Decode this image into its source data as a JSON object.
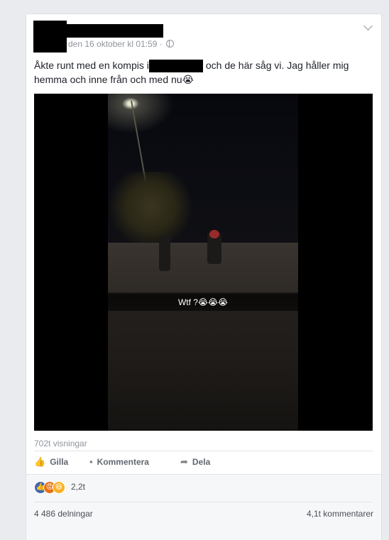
{
  "post": {
    "timestamp": "den 16 oktober kl 01:59 ·",
    "text_part1": "Åkte runt med en kompis i",
    "text_part2": "och de här såg vi. Jag håller mig hemma och inne från och med nu",
    "text_emoji": "😭"
  },
  "video": {
    "caption": "Wtf ?😭😭😭",
    "views": "702t visningar"
  },
  "actions": {
    "like_label": "Gilla",
    "comment_label": "Kommentera",
    "share_label": "Dela"
  },
  "reactions": {
    "count": "2,2t",
    "icons": [
      "like-icon",
      "angry-icon",
      "haha-icon"
    ]
  },
  "stats": {
    "shares": "4 486 delningar",
    "comments": "4,1t kommentarer"
  },
  "colors": {
    "background": "#e9ebee",
    "like_blue": "#4267b2",
    "meta_gray": "#90949c"
  }
}
